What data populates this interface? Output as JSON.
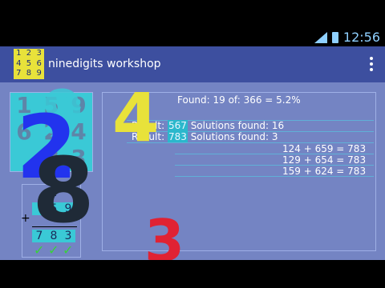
{
  "status": {
    "time": "12:56",
    "network": "3G"
  },
  "app": {
    "title": "ninedigits workshop",
    "logo_digits": [
      "1",
      "2",
      "3",
      "4",
      "5",
      "6",
      "7",
      "8",
      "9"
    ]
  },
  "grid": {
    "cells": [
      "1",
      "5",
      "9",
      "6",
      "2",
      "4",
      "",
      "8",
      "3"
    ]
  },
  "sum": {
    "row1": [
      "",
      "2",
      ""
    ],
    "row2": [
      "",
      "5",
      "9"
    ],
    "result": [
      "7",
      "8",
      "3"
    ],
    "plus": "+",
    "ticks": [
      "✓",
      "✓",
      "✓"
    ]
  },
  "results": {
    "found": "Found: 19 of: 366 = 5.2%",
    "line1_prefix": "Result:",
    "line1_value": "567",
    "line1_suffix": "Solutions found: 16",
    "line2_prefix": "Result:",
    "line2_value": "783",
    "line2_suffix": "Solutions found: 3",
    "equations": [
      "124 + 659 = 783",
      "129 + 654 = 783",
      "159 + 624 = 783"
    ]
  },
  "overlay_digits": {
    "blue": "2",
    "dark": "8",
    "yellow": "4",
    "red": "3",
    "cyan": "9"
  },
  "colors": {
    "accent": "#3d4f9f",
    "background": "#7484c3",
    "highlight": "#2bb8cc",
    "yellow": "#e8e23a"
  }
}
